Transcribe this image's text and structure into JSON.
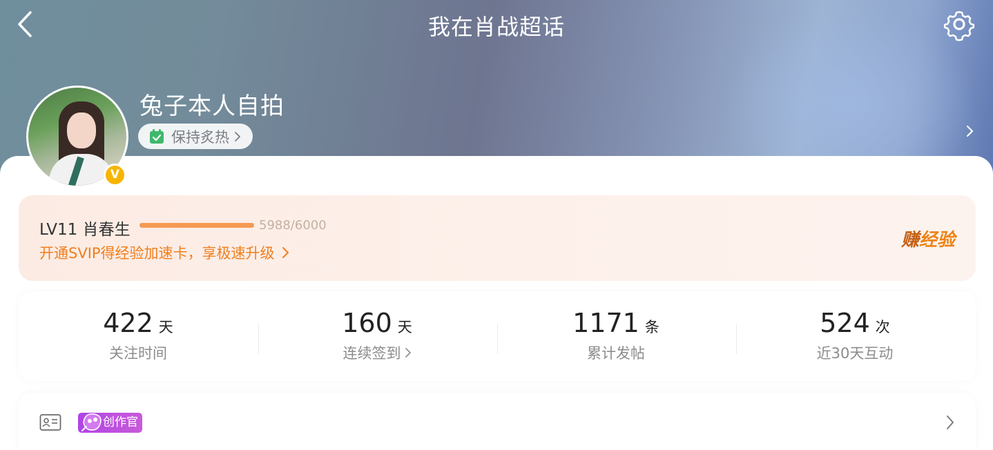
{
  "header": {
    "title": "我在肖战超话",
    "back_icon": "chevron-left-icon",
    "settings_icon": "gear-icon"
  },
  "profile": {
    "username": "兔子本人自拍",
    "verified_badge": "V",
    "status_chip": {
      "icon": "calendar-check-icon",
      "label": "保持炙热"
    }
  },
  "level": {
    "label": "LV11 肖春生",
    "progress_text": "5988/6000",
    "progress_fraction": 0.998,
    "vip_promo": "开通SVIP得经验加速卡，享极速升级",
    "earn_button_first": "赚",
    "earn_button_rest": "经验",
    "accent_color": "#f07f1e"
  },
  "stats": [
    {
      "value": "422",
      "unit": "天",
      "label": "关注时间",
      "has_arrow": false
    },
    {
      "value": "160",
      "unit": "天",
      "label": "连续签到",
      "has_arrow": true
    },
    {
      "value": "1171",
      "unit": "条",
      "label": "累计发帖",
      "has_arrow": false
    },
    {
      "value": "524",
      "unit": "次",
      "label": "近30天互动",
      "has_arrow": false
    }
  ],
  "creator": {
    "id_icon": "id-card-icon",
    "badge_label": "创作官",
    "badge_color": "#b044e6"
  }
}
